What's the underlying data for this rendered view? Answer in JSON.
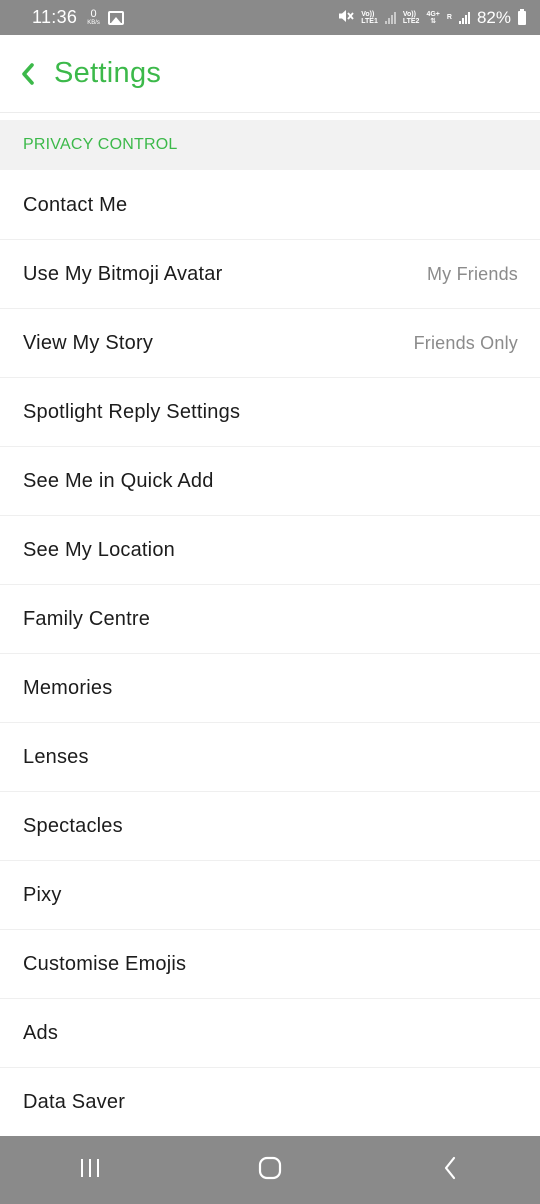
{
  "status_bar": {
    "time": "11:36",
    "speed_value": "0",
    "speed_unit": "KB/s",
    "sim1_label_top": "Vo))",
    "sim1_label_bottom": "LTE1",
    "sim2_label_top": "Vo))",
    "sim2_label_bottom": "LTE2",
    "network_type": "4G+",
    "network_sub": "R",
    "battery_percent": "82%",
    "battery_level": 82
  },
  "header": {
    "title": "Settings"
  },
  "section": {
    "title": "PRIVACY CONTROL"
  },
  "items": [
    {
      "label": "Contact Me",
      "value": ""
    },
    {
      "label": "Use My Bitmoji Avatar",
      "value": "My Friends"
    },
    {
      "label": "View My Story",
      "value": "Friends Only"
    },
    {
      "label": "Spotlight Reply Settings",
      "value": ""
    },
    {
      "label": "See Me in Quick Add",
      "value": ""
    },
    {
      "label": "See My Location",
      "value": ""
    },
    {
      "label": "Family Centre",
      "value": ""
    },
    {
      "label": "Memories",
      "value": ""
    },
    {
      "label": "Lenses",
      "value": ""
    },
    {
      "label": "Spectacles",
      "value": ""
    },
    {
      "label": "Pixy",
      "value": ""
    },
    {
      "label": "Customise Emojis",
      "value": ""
    },
    {
      "label": "Ads",
      "value": ""
    },
    {
      "label": "Data Saver",
      "value": ""
    }
  ],
  "nav": {
    "recents_icon": "recents-icon",
    "home_icon": "home-icon",
    "back_icon": "back-icon"
  },
  "colors": {
    "accent": "#3cb94a",
    "system_bar": "#8a8a8a",
    "section_bg": "#f2f2f2",
    "value_text": "#8b8b8b"
  }
}
